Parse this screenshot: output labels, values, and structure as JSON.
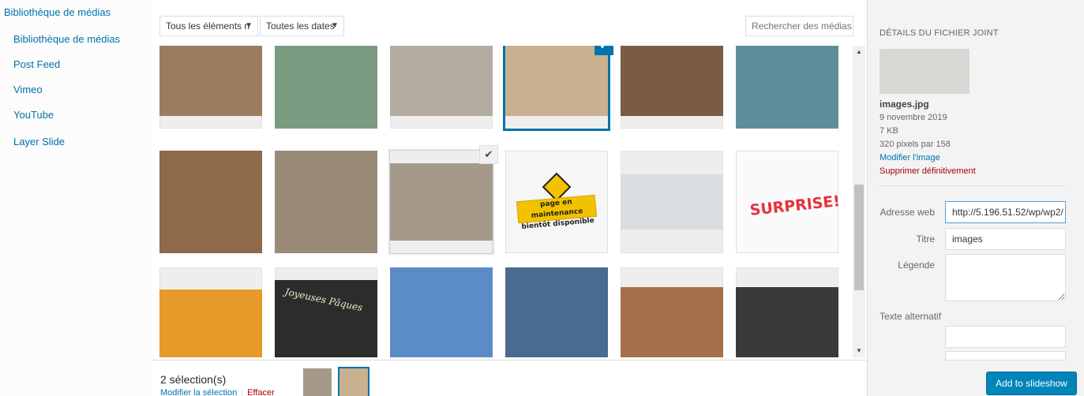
{
  "sidebar": {
    "items": [
      {
        "label": "Bibliothèque de médias",
        "id": "main"
      },
      {
        "label": "Bibliothèque de médias",
        "id": "lib"
      },
      {
        "label": "Post Feed",
        "id": "postfeed"
      },
      {
        "label": "Vimeo",
        "id": "vimeo"
      },
      {
        "label": "YouTube",
        "id": "youtube"
      },
      {
        "label": "Layer Slide",
        "id": "layerslide"
      }
    ]
  },
  "toolbar": {
    "filter_type": "Tous les éléments n",
    "filter_date": "Toutes les dates",
    "search_placeholder": "Rechercher des médias..."
  },
  "grid": {
    "images": [
      {
        "name": "wooden-egg-holder",
        "color": "#9b7c5f"
      },
      {
        "name": "green-wood-frame",
        "color": "#7a9b80"
      },
      {
        "name": "pallet-sofa",
        "color": "#b4aba1"
      },
      {
        "name": "stool-stack",
        "color": "#c9b18f"
      },
      {
        "name": "drawer-cabinet",
        "color": "#7a5c42"
      },
      {
        "name": "blue-tile-cabinet",
        "color": "#5f8c9a"
      },
      {
        "name": "barrel-table",
        "color": "#8c6a4a"
      },
      {
        "name": "reception-desk",
        "color": "#9a8a78"
      },
      {
        "name": "workshop",
        "color": "#a59a8a"
      },
      {
        "name": "maintenance-sign",
        "color": "#ffffff"
      },
      {
        "name": "screenshot",
        "color": "#d9dde2"
      },
      {
        "name": "surprise-gift",
        "color": "#ffffff"
      },
      {
        "name": "sunset-jump",
        "color": "#e59a2a"
      },
      {
        "name": "joyeuses-paques",
        "color": "#2c2c2c"
      },
      {
        "name": "park-guell",
        "color": "#5b8cc7"
      },
      {
        "name": "skyscrapers",
        "color": "#4a6b8f"
      },
      {
        "name": "sandwiches",
        "color": "#a6704a"
      },
      {
        "name": "coffee-chalkboard",
        "color": "#3a3a3a"
      }
    ],
    "maintenance_line1": "page en maintenance",
    "maintenance_line2": "bientôt disponible",
    "surprise_text": "SURPRISE!",
    "paques_text": "Joyeuses Pâques",
    "check": "✔"
  },
  "bottom": {
    "count": "2 sélection(s)",
    "edit": "Modifier la sélection",
    "clear": "Effacer"
  },
  "panel": {
    "title": "DÉTAILS DU FICHIER JOINT",
    "filename": "images.jpg",
    "date": "9 novembre 2019",
    "size": "7 KB",
    "dimensions": "320 pixels par 158",
    "edit_image": "Modifier l'image",
    "delete": "Supprimer définitivement",
    "url_label": "Adresse web",
    "url_value": "http://5.196.51.52/wp/wp2/",
    "title_label": "Titre",
    "title_value": "images",
    "caption_label": "Légende",
    "alt_label": "Texte alternatif",
    "button": "Add to slideshow"
  },
  "colors": {
    "accent": "#0073aa",
    "danger": "#a00",
    "primary_button": "#0085ba"
  }
}
